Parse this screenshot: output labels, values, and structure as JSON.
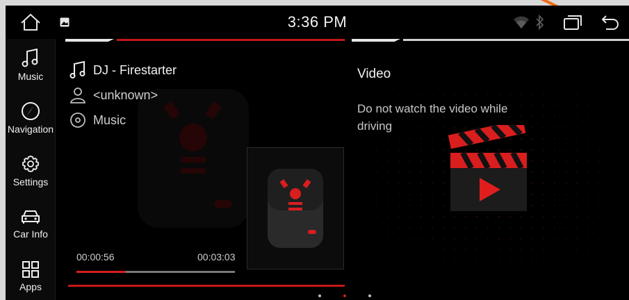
{
  "status_bar": {
    "time": "3:36 PM"
  },
  "sidebar": {
    "items": [
      {
        "label": "Music",
        "icon": "music-note-icon"
      },
      {
        "label": "Navigation",
        "icon": "navigation-arrow-icon"
      },
      {
        "label": "Settings",
        "icon": "gear-icon"
      },
      {
        "label": "Car Info",
        "icon": "car-icon"
      },
      {
        "label": "Apps",
        "icon": "apps-grid-icon"
      }
    ]
  },
  "music": {
    "track_title": "DJ - Firestarter",
    "artist": "<unknown>",
    "album": "Music",
    "elapsed": "00:00:56",
    "duration": "00:03:03",
    "progress": 0.31
  },
  "video": {
    "title": "Video",
    "warning": "Do not watch the video while driving"
  },
  "pager": {
    "count": 3,
    "active_index": 1
  },
  "colors": {
    "accent_red": "#d81e1e",
    "background": "#000000",
    "annotation_orange": "#f06a12"
  }
}
